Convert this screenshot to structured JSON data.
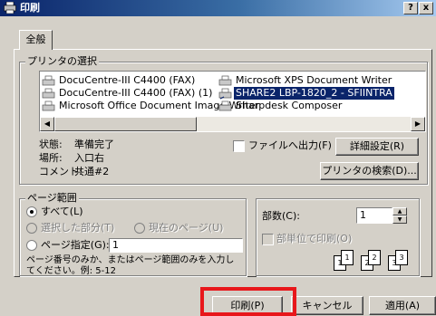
{
  "window": {
    "title": "印刷",
    "help_label": "?",
    "close_label": "x"
  },
  "tabs": [
    {
      "label": "全般"
    }
  ],
  "printer_select": {
    "legend": "プリンタの選択",
    "printers": [
      {
        "label": "DocuCentre-III C4400 (FAX)",
        "selected": false
      },
      {
        "label": "DocuCentre-III C4400 (FAX) (1)",
        "selected": false
      },
      {
        "label": "Microsoft Office Document Image Writer",
        "selected": false
      },
      {
        "label": "Microsoft XPS Document Writer",
        "selected": false
      },
      {
        "label": "SHARE2 LBP-1820_2 - SFIINTRA",
        "selected": true
      },
      {
        "label": "Sharpdesk Composer",
        "selected": false
      }
    ],
    "status_label": "状態:",
    "status_value": "準備完了",
    "location_label": "場所:",
    "location_value": "入口右",
    "comment_label": "コメント:",
    "comment_value": "共通#2",
    "print_to_file_label": "ファイルへ出力(F)",
    "print_to_file_checked": false,
    "preferences_label": "詳細設定(R)",
    "find_printer_label": "プリンタの検索(D)..."
  },
  "page_range": {
    "legend": "ページ範囲",
    "all_label": "すべて(L)",
    "selection_label": "選択した部分(T)",
    "current_page_label": "現在のページ(U)",
    "pages_label": "ページ指定(G):",
    "pages_value": "1",
    "hint": "ページ番号のみか、またはページ範囲のみを入力してください。例: 5-12"
  },
  "copies": {
    "label": "部数(C):",
    "value": "1",
    "collate_label": "部単位で印刷(O)",
    "collate_icon_numbers": [
      "1",
      "1",
      "2",
      "2",
      "3",
      "3"
    ]
  },
  "footer": {
    "print_label": "印刷(P)",
    "cancel_label": "キャンセル",
    "apply_label": "適用(A)"
  },
  "accent_colors": {
    "titlebar": "#0a246a",
    "highlight_box": "#e8171b",
    "selection": "#0a246a"
  }
}
